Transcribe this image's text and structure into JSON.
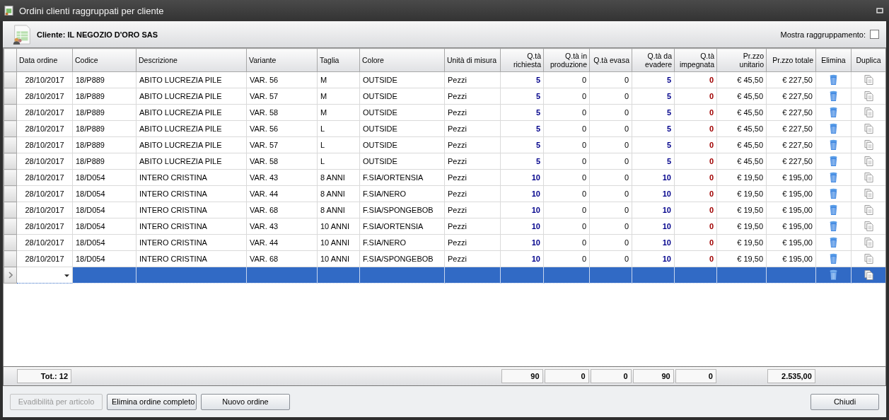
{
  "window": {
    "title": "Ordini clienti raggruppati per cliente"
  },
  "header": {
    "client_label": "Cliente: IL NEGOZIO D'ORO SAS",
    "grouping": {
      "label": "Mostra raggruppamento:",
      "checked": false
    }
  },
  "columns": {
    "data_ordine": "Data ordine",
    "codice": "Codice",
    "descrizione": "Descrizione",
    "variante": "Variante",
    "taglia": "Taglia",
    "colore": "Colore",
    "unita": "Unità di misura",
    "q_richiesta": "Q.tà richiesta",
    "q_produzione": "Q.tà in produzione",
    "q_evasa": "Q.tà evasa",
    "q_evadere": "Q.tà da evadere",
    "q_impegnata": "Q.tà impegnata",
    "prezzo_unitario": "Pr.zzo unitario",
    "prezzo_totale": "Pr.zzo totale",
    "elimina": "Elimina",
    "duplica": "Duplica"
  },
  "rows": [
    {
      "selected": false,
      "data_ordine": "28/10/2017",
      "codice": "18/P889",
      "descrizione": "ABITO LUCREZIA PILE",
      "variante": "VAR. 56",
      "taglia": "M",
      "colore": "OUTSIDE",
      "unita": "Pezzi",
      "q_richiesta": "5",
      "q_produzione": "0",
      "q_evasa": "0",
      "q_evadere": "5",
      "q_impegnata": "0",
      "prezzo_unitario": "€ 45,50",
      "prezzo_totale": "€ 227,50"
    },
    {
      "selected": false,
      "data_ordine": "28/10/2017",
      "codice": "18/P889",
      "descrizione": "ABITO LUCREZIA PILE",
      "variante": "VAR. 57",
      "taglia": "M",
      "colore": "OUTSIDE",
      "unita": "Pezzi",
      "q_richiesta": "5",
      "q_produzione": "0",
      "q_evasa": "0",
      "q_evadere": "5",
      "q_impegnata": "0",
      "prezzo_unitario": "€ 45,50",
      "prezzo_totale": "€ 227,50"
    },
    {
      "selected": false,
      "data_ordine": "28/10/2017",
      "codice": "18/P889",
      "descrizione": "ABITO LUCREZIA PILE",
      "variante": "VAR. 58",
      "taglia": "M",
      "colore": "OUTSIDE",
      "unita": "Pezzi",
      "q_richiesta": "5",
      "q_produzione": "0",
      "q_evasa": "0",
      "q_evadere": "5",
      "q_impegnata": "0",
      "prezzo_unitario": "€ 45,50",
      "prezzo_totale": "€ 227,50"
    },
    {
      "selected": false,
      "data_ordine": "28/10/2017",
      "codice": "18/P889",
      "descrizione": "ABITO LUCREZIA PILE",
      "variante": "VAR. 56",
      "taglia": "L",
      "colore": "OUTSIDE",
      "unita": "Pezzi",
      "q_richiesta": "5",
      "q_produzione": "0",
      "q_evasa": "0",
      "q_evadere": "5",
      "q_impegnata": "0",
      "prezzo_unitario": "€ 45,50",
      "prezzo_totale": "€ 227,50"
    },
    {
      "selected": false,
      "data_ordine": "28/10/2017",
      "codice": "18/P889",
      "descrizione": "ABITO LUCREZIA PILE",
      "variante": "VAR. 57",
      "taglia": "L",
      "colore": "OUTSIDE",
      "unita": "Pezzi",
      "q_richiesta": "5",
      "q_produzione": "0",
      "q_evasa": "0",
      "q_evadere": "5",
      "q_impegnata": "0",
      "prezzo_unitario": "€ 45,50",
      "prezzo_totale": "€ 227,50"
    },
    {
      "selected": false,
      "data_ordine": "28/10/2017",
      "codice": "18/P889",
      "descrizione": "ABITO LUCREZIA PILE",
      "variante": "VAR. 58",
      "taglia": "L",
      "colore": "OUTSIDE",
      "unita": "Pezzi",
      "q_richiesta": "5",
      "q_produzione": "0",
      "q_evasa": "0",
      "q_evadere": "5",
      "q_impegnata": "0",
      "prezzo_unitario": "€ 45,50",
      "prezzo_totale": "€ 227,50"
    },
    {
      "selected": false,
      "data_ordine": "28/10/2017",
      "codice": "18/D054",
      "descrizione": "INTERO CRISTINA",
      "variante": "VAR. 43",
      "taglia": "8 ANNI",
      "colore": "F.SIA/ORTENSIA",
      "unita": "Pezzi",
      "q_richiesta": "10",
      "q_produzione": "0",
      "q_evasa": "0",
      "q_evadere": "10",
      "q_impegnata": "0",
      "prezzo_unitario": "€ 19,50",
      "prezzo_totale": "€ 195,00"
    },
    {
      "selected": false,
      "data_ordine": "28/10/2017",
      "codice": "18/D054",
      "descrizione": "INTERO CRISTINA",
      "variante": "VAR. 44",
      "taglia": "8 ANNI",
      "colore": "F.SIA/NERO",
      "unita": "Pezzi",
      "q_richiesta": "10",
      "q_produzione": "0",
      "q_evasa": "0",
      "q_evadere": "10",
      "q_impegnata": "0",
      "prezzo_unitario": "€ 19,50",
      "prezzo_totale": "€ 195,00"
    },
    {
      "selected": false,
      "data_ordine": "28/10/2017",
      "codice": "18/D054",
      "descrizione": "INTERO CRISTINA",
      "variante": "VAR. 68",
      "taglia": "8 ANNI",
      "colore": "F.SIA/SPONGEBOB",
      "unita": "Pezzi",
      "q_richiesta": "10",
      "q_produzione": "0",
      "q_evasa": "0",
      "q_evadere": "10",
      "q_impegnata": "0",
      "prezzo_unitario": "€ 19,50",
      "prezzo_totale": "€ 195,00"
    },
    {
      "selected": false,
      "data_ordine": "28/10/2017",
      "codice": "18/D054",
      "descrizione": "INTERO CRISTINA",
      "variante": "VAR. 43",
      "taglia": "10 ANNI",
      "colore": "F.SIA/ORTENSIA",
      "unita": "Pezzi",
      "q_richiesta": "10",
      "q_produzione": "0",
      "q_evasa": "0",
      "q_evadere": "10",
      "q_impegnata": "0",
      "prezzo_unitario": "€ 19,50",
      "prezzo_totale": "€ 195,00"
    },
    {
      "selected": false,
      "data_ordine": "28/10/2017",
      "codice": "18/D054",
      "descrizione": "INTERO CRISTINA",
      "variante": "VAR. 44",
      "taglia": "10 ANNI",
      "colore": "F.SIA/NERO",
      "unita": "Pezzi",
      "q_richiesta": "10",
      "q_produzione": "0",
      "q_evasa": "0",
      "q_evadere": "10",
      "q_impegnata": "0",
      "prezzo_unitario": "€ 19,50",
      "prezzo_totale": "€ 195,00"
    },
    {
      "selected": false,
      "data_ordine": "28/10/2017",
      "codice": "18/D054",
      "descrizione": "INTERO CRISTINA",
      "variante": "VAR. 68",
      "taglia": "10 ANNI",
      "colore": "F.SIA/SPONGEBOB",
      "unita": "Pezzi",
      "q_richiesta": "10",
      "q_produzione": "0",
      "q_evasa": "0",
      "q_evadere": "10",
      "q_impegnata": "0",
      "prezzo_unitario": "€ 19,50",
      "prezzo_totale": "€ 195,00"
    }
  ],
  "new_row": {
    "selected": true
  },
  "totals": {
    "data_ordine": "Tot.: 12",
    "q_richiesta": "90",
    "q_produzione": "0",
    "q_evasa": "0",
    "q_evadere": "90",
    "q_impegnata": "0",
    "prezzo_totale": "2.535,00"
  },
  "buttons": [
    {
      "label": "Evadibilità per articolo",
      "disabled": true
    },
    {
      "label": "Elimina ordine completo",
      "disabled": false
    },
    {
      "label": "Nuovo ordine",
      "disabled": false
    }
  ],
  "close_button": {
    "label": "Chiudi",
    "disabled": false
  }
}
